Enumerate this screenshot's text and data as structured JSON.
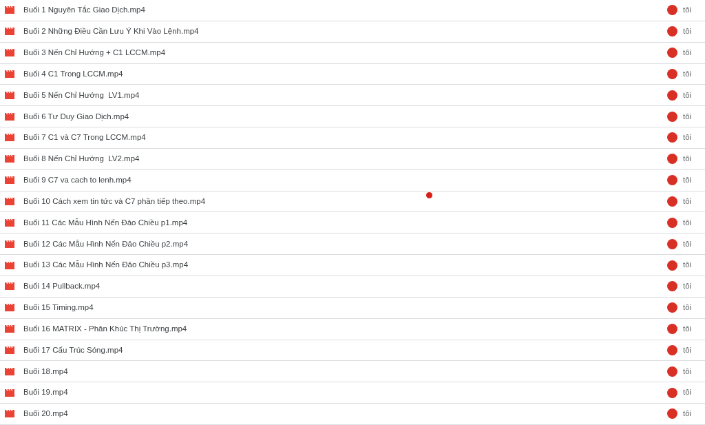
{
  "files": [
    {
      "name": "Buổi 1 Nguyên Tắc Giao Dịch.mp4",
      "owner": "tôi"
    },
    {
      "name": "Buổi 2 Những Điều Cần Lưu Ý Khi Vào Lệnh.mp4",
      "owner": "tôi"
    },
    {
      "name": "Buổi 3 Nến Chỉ Hướng + C1 LCCM.mp4",
      "owner": "tôi"
    },
    {
      "name": "Buổi 4 C1 Trong LCCM.mp4",
      "owner": "tôi"
    },
    {
      "name": "Buổi 5 Nến Chỉ Hướng  LV1.mp4",
      "owner": "tôi"
    },
    {
      "name": "Buổi 6 Tư Duy Giao Dịch.mp4",
      "owner": "tôi"
    },
    {
      "name": "Buổi 7 C1 và C7 Trong LCCM.mp4",
      "owner": "tôi"
    },
    {
      "name": "Buổi 8 Nến Chỉ Hướng  LV2.mp4",
      "owner": "tôi"
    },
    {
      "name": "Buổi 9 C7 va cach to lenh.mp4",
      "owner": "tôi"
    },
    {
      "name": "Buổi 10 Cách xem tin tức và C7 phần tiếp theo.mp4",
      "owner": "tôi"
    },
    {
      "name": "Buổi 11 Các Mẫu Hình Nến Đảo Chiều p1.mp4",
      "owner": "tôi"
    },
    {
      "name": "Buổi 12 Các Mẫu Hình Nến Đảo Chiều p2.mp4",
      "owner": "tôi"
    },
    {
      "name": "Buổi 13 Các Mẫu Hình Nến Đảo Chiều p3.mp4",
      "owner": "tôi"
    },
    {
      "name": "Buổi 14 Pullback.mp4",
      "owner": "tôi"
    },
    {
      "name": "Buổi 15 Timing.mp4",
      "owner": "tôi"
    },
    {
      "name": "Buổi 16 MATRIX - Phân Khúc Thị Trường.mp4",
      "owner": "tôi"
    },
    {
      "name": "Buổi 17 Cấu Trúc Sóng.mp4",
      "owner": "tôi"
    },
    {
      "name": "Buổi 18.mp4",
      "owner": "tôi"
    },
    {
      "name": "Buổi 19.mp4",
      "owner": "tôi"
    },
    {
      "name": "Buổi 20.mp4",
      "owner": "tôi"
    }
  ]
}
